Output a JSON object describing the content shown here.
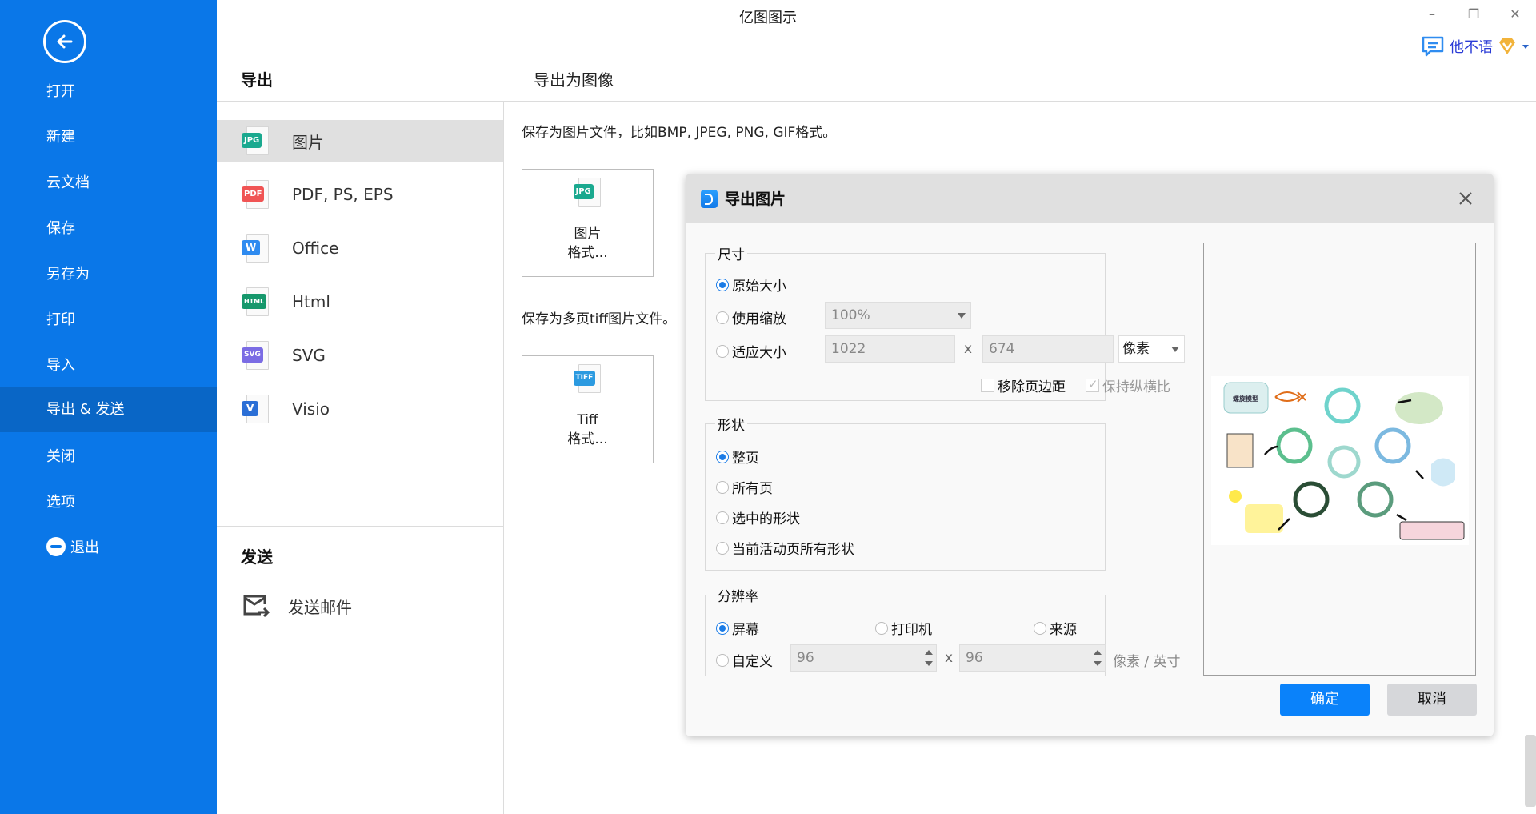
{
  "window": {
    "title": "亿图图示",
    "minimize_label": "–",
    "restore_label": "❐",
    "close_label": "✕",
    "user_name": "他不语",
    "comment_icon": "comment-icon",
    "vip_icon": "vip-badge-icon"
  },
  "sidebar": {
    "back_icon": "back-arrow-icon",
    "items": [
      {
        "label": "打开"
      },
      {
        "label": "新建"
      },
      {
        "label": "云文档"
      },
      {
        "label": "保存"
      },
      {
        "label": "另存为"
      },
      {
        "label": "打印"
      },
      {
        "label": "导入"
      },
      {
        "label": "导出 & 发送",
        "active": true
      },
      {
        "label": "关闭"
      },
      {
        "label": "选项"
      },
      {
        "label": "退出",
        "icon": "exit-icon"
      }
    ]
  },
  "export_panel": {
    "header": "导出",
    "items": [
      {
        "label": "图片",
        "tag": "JPG",
        "color": "#1aa98f",
        "active": true
      },
      {
        "label": "PDF, PS, EPS",
        "tag": "PDF",
        "color": "#f05454"
      },
      {
        "label": "Office",
        "tag": "W",
        "color": "#2f8bf0"
      },
      {
        "label": "Html",
        "tag": "HTML",
        "color": "#16986c"
      },
      {
        "label": "SVG",
        "tag": "SVG",
        "color": "#7b6ce4"
      },
      {
        "label": "Visio",
        "tag": "V",
        "color": "#2b6fd6"
      }
    ],
    "send_header": "发送",
    "send_items": [
      {
        "label": "发送邮件",
        "icon": "send-mail-icon"
      }
    ]
  },
  "content": {
    "title": "导出为图像",
    "image_desc": "保存为图片文件，比如BMP, JPEG, PNG, GIF格式。",
    "image_button": {
      "tag": "JPG",
      "color": "#1aa98f",
      "line1": "图片",
      "line2": "格式..."
    },
    "tiff_desc": "保存为多页tiff图片文件。",
    "tiff_button": {
      "tag": "TIFF",
      "color": "#2b9ae0",
      "line1": "Tiff",
      "line2": "格式..."
    }
  },
  "dialog": {
    "title": "导出图片",
    "size_group": {
      "legend": "尺寸",
      "options": [
        {
          "label": "原始大小",
          "checked": true
        },
        {
          "label": "使用缩放",
          "checked": false
        },
        {
          "label": "适应大小",
          "checked": false
        }
      ],
      "zoom_value": "100%",
      "width_value": "1022",
      "height_value": "674",
      "x_sep": "x",
      "unit_value": "像素",
      "remove_margin_label": "移除页边距",
      "remove_margin_checked": false,
      "keep_ratio_label": "保持纵横比",
      "keep_ratio_checked": true
    },
    "shape_group": {
      "legend": "形状",
      "options": [
        {
          "label": "整页",
          "checked": true
        },
        {
          "label": "所有页",
          "checked": false
        },
        {
          "label": "选中的形状",
          "checked": false
        },
        {
          "label": "当前活动页所有形状",
          "checked": false
        }
      ]
    },
    "resolution_group": {
      "legend": "分辨率",
      "options": [
        {
          "label": "屏幕",
          "checked": true
        },
        {
          "label": "打印机",
          "checked": false
        },
        {
          "label": "来源",
          "checked": false
        },
        {
          "label": "自定义",
          "checked": false
        }
      ],
      "dpi_x": "96",
      "dpi_y": "96",
      "x_sep": "x",
      "unit": "像素 / 英寸"
    },
    "preview": {
      "diagram_title": "螺旋模型"
    },
    "ok_label": "确定",
    "cancel_label": "取消"
  }
}
